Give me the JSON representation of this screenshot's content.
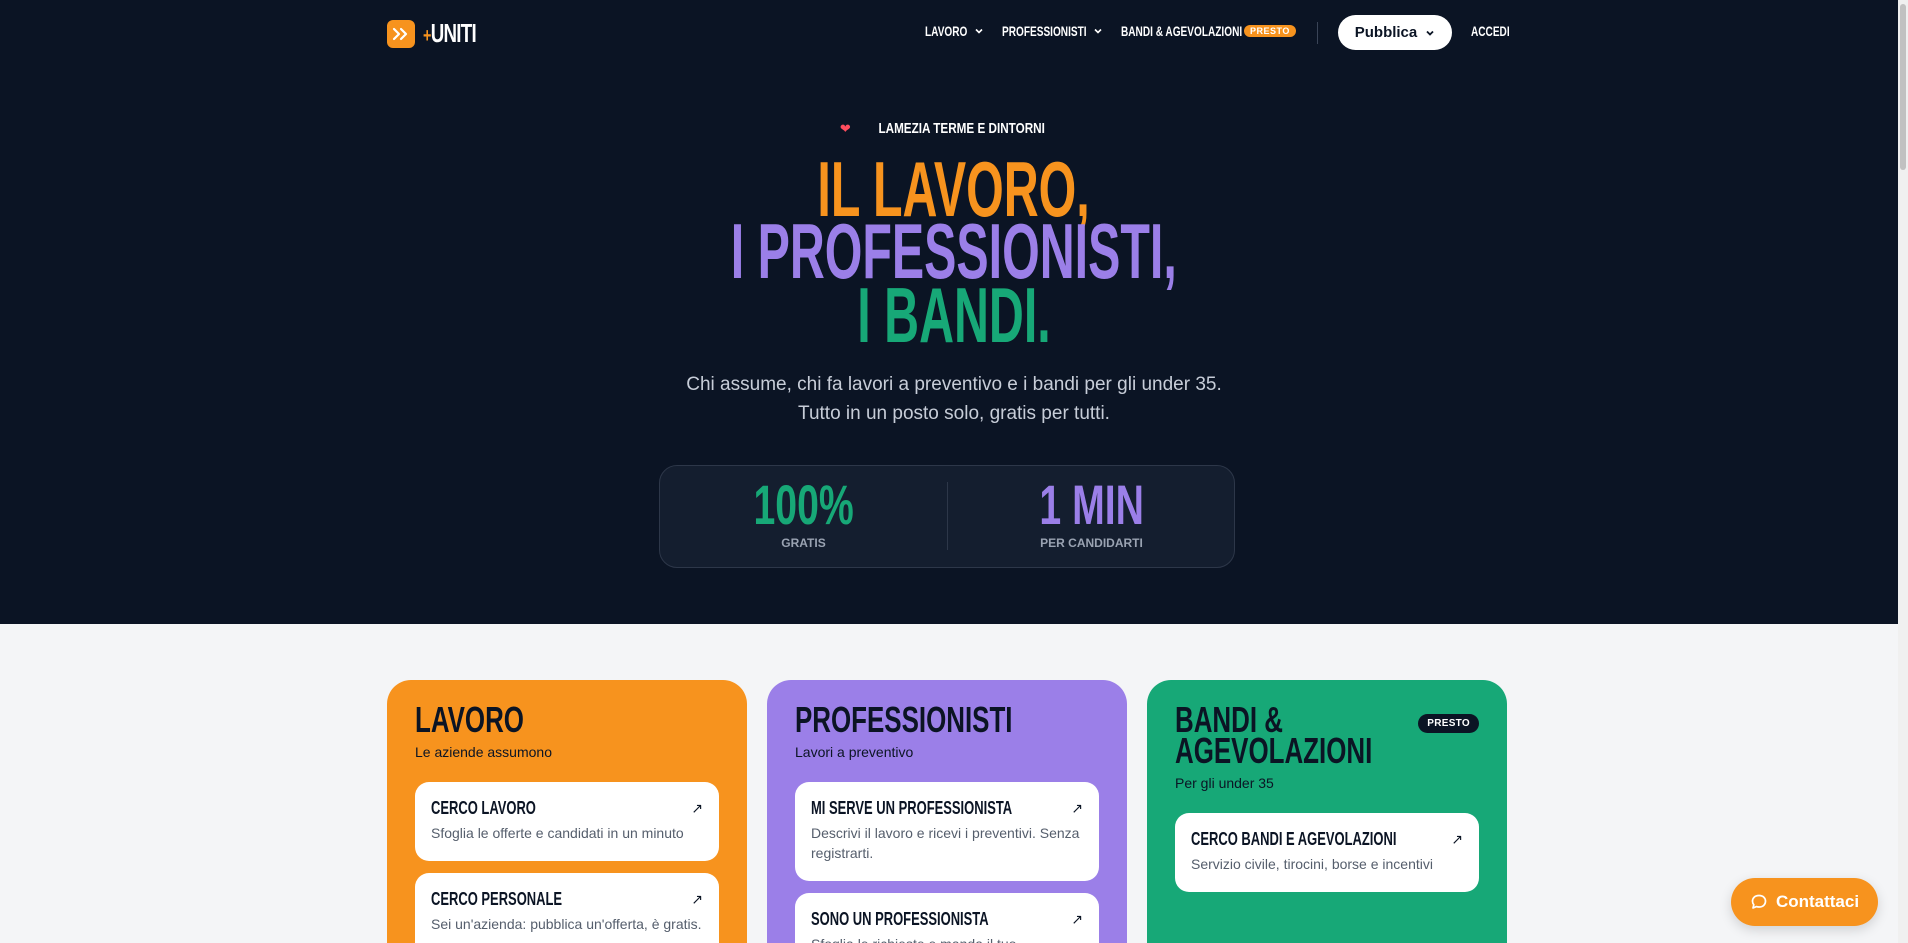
{
  "brand": {
    "logo_text": "UNITI",
    "logo_plus": "+"
  },
  "nav": {
    "lavoro": "LAVORO",
    "professionisti": "PROFESSIONISTI",
    "bandi": "BANDI & AGEVOLAZIONI",
    "bandi_badge": "PRESTO",
    "pubblica": "Pubblica",
    "accedi": "ACCEDI"
  },
  "hero": {
    "location": "LAMEZIA TERME E DINTORNI",
    "headline": [
      "IL LAVORO,",
      "I PROFESSIONISTI,",
      "I BANDI."
    ],
    "subtitle_1": "Chi assume, chi fa lavori a preventivo e i bandi per gli under 35.",
    "subtitle_2": "Tutto in un posto solo, gratis per tutti.",
    "stats": [
      {
        "value": "100%",
        "label": "GRATIS"
      },
      {
        "value": "1 MIN",
        "label": "PER CANDIDARTI"
      }
    ]
  },
  "cards": [
    {
      "title": [
        "LAVORO"
      ],
      "subtitle": "Le aziende assumono",
      "items": [
        {
          "title": "CERCO LAVORO",
          "desc": "Sfoglia le offerte e candidati in un minuto"
        },
        {
          "title": "CERCO PERSONALE",
          "desc": "Sei un'azienda: pubblica un'offerta, è gratis."
        }
      ]
    },
    {
      "title": [
        "PROFESSIONISTI"
      ],
      "subtitle": "Lavori a preventivo",
      "items": [
        {
          "title": "MI SERVE UN PROFESSIONISTA",
          "desc": "Descrivi il lavoro e ricevi i preventivi. Senza registrarti."
        },
        {
          "title": "SONO UN PROFESSIONISTA",
          "desc": "Sfoglia le richieste e manda il tuo preventivo."
        }
      ]
    },
    {
      "title": [
        "BANDI &",
        "AGEVOLAZIONI"
      ],
      "subtitle": "Per gli under 35",
      "badge": "PRESTO",
      "items": [
        {
          "title": "CERCO BANDI E AGEVOLAZIONI",
          "desc": "Servizio civile, tirocini, borse e incentivi"
        }
      ]
    }
  ],
  "contact_button": "Contattaci",
  "colors": {
    "orange": "#f7931e",
    "purple": "#9b7fe8",
    "green": "#17a877",
    "navy": "#0b1424"
  }
}
